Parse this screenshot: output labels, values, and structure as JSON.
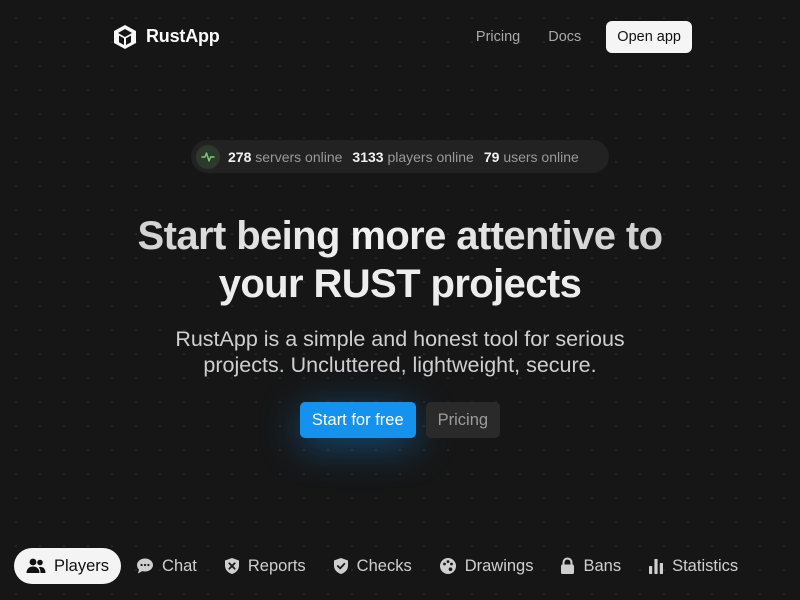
{
  "header": {
    "brand_name": "RustApp",
    "nav": [
      {
        "label": "Pricing"
      },
      {
        "label": "Docs"
      }
    ],
    "open_app_label": "Open app"
  },
  "stats": {
    "icon": "activity-icon",
    "servers": {
      "value": "278",
      "label": "servers online"
    },
    "players": {
      "value": "3133",
      "label": "players online"
    },
    "users": {
      "value": "79",
      "label": "users online"
    }
  },
  "hero": {
    "title_line1": "Start being more attentive to",
    "title_line2": "your RUST projects",
    "subtitle": "RustApp is a simple and honest tool for serious projects. Uncluttered, lightweight, secure.",
    "cta_primary": "Start for free",
    "cta_secondary": "Pricing"
  },
  "tabs": [
    {
      "label": "Players",
      "icon": "users-icon",
      "active": true
    },
    {
      "label": "Chat",
      "icon": "chat-icon",
      "active": false
    },
    {
      "label": "Reports",
      "icon": "report-shield-icon",
      "active": false
    },
    {
      "label": "Checks",
      "icon": "check-shield-icon",
      "active": false
    },
    {
      "label": "Drawings",
      "icon": "palette-icon",
      "active": false
    },
    {
      "label": "Bans",
      "icon": "lock-icon",
      "active": false
    },
    {
      "label": "Statistics",
      "icon": "bar-chart-icon",
      "active": false
    }
  ],
  "colors": {
    "background": "#161616",
    "accent": "#1591ee",
    "active_tab_bg": "#f4f4f4"
  }
}
